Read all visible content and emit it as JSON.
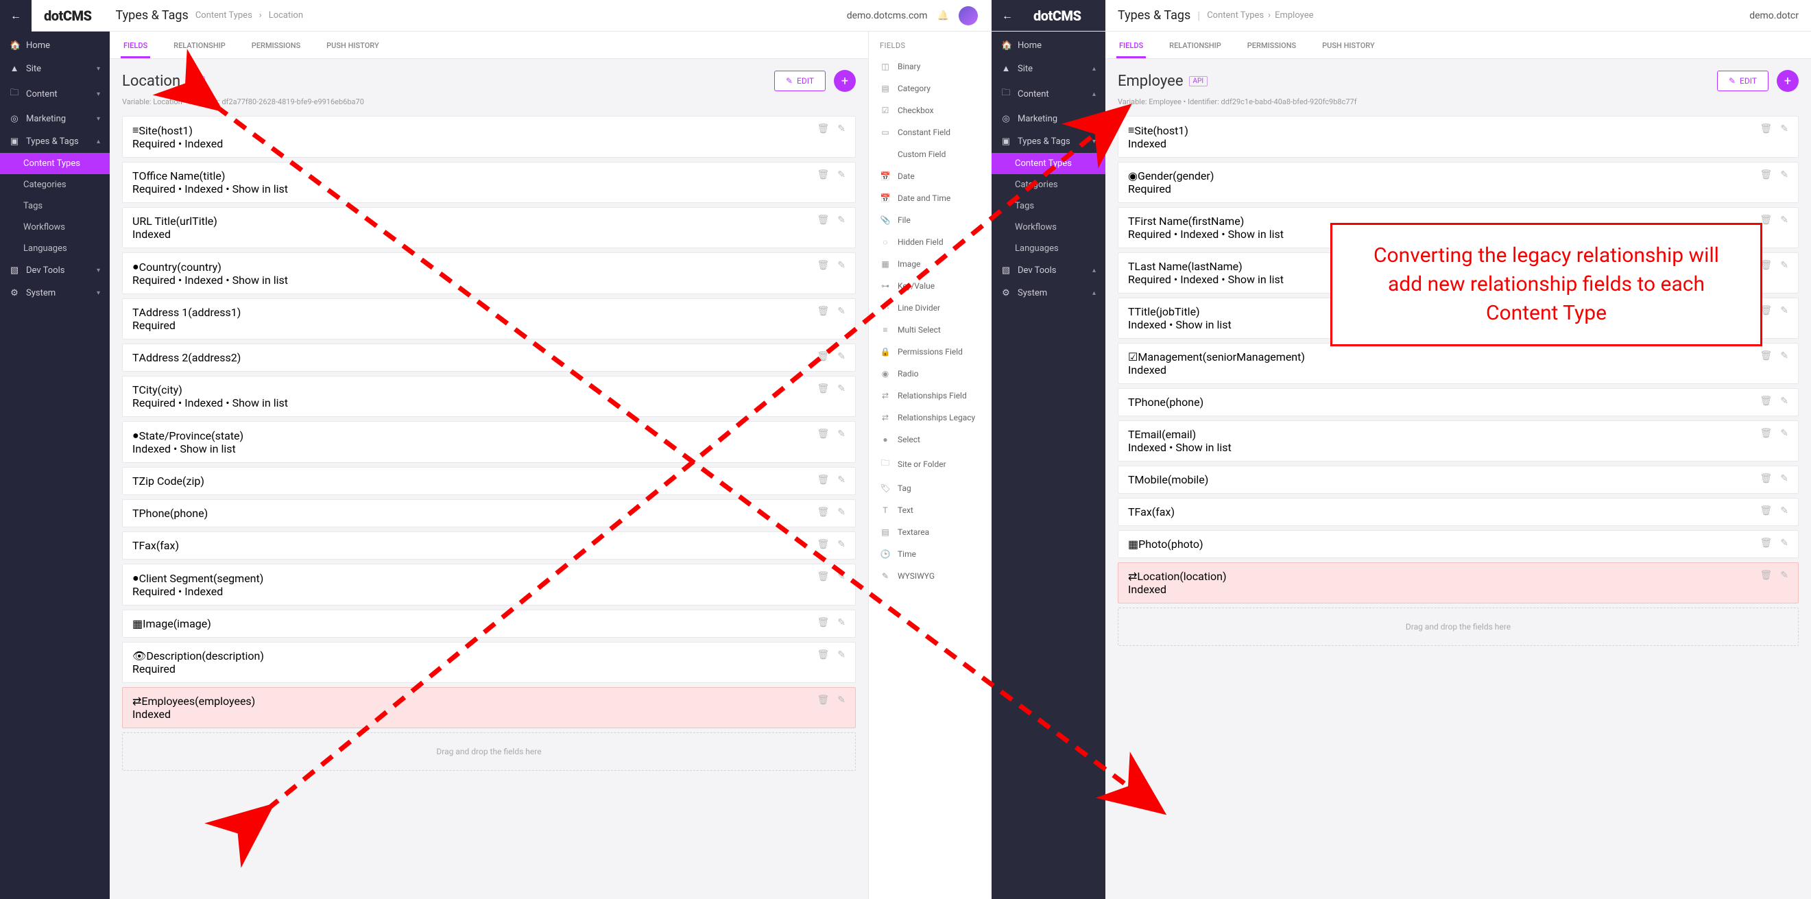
{
  "left": {
    "header": {
      "section": "Types & Tags",
      "crumb1": "Content Types",
      "crumb2": "Location",
      "domain": "demo.dotcms.com"
    },
    "nav": {
      "home": "Home",
      "site": "Site",
      "content": "Content",
      "marketing": "Marketing",
      "types": "Types & Tags",
      "contentTypes": "Content Types",
      "categories": "Categories",
      "tags": "Tags",
      "workflows": "Workflows",
      "languages": "Languages",
      "devtools": "Dev Tools",
      "system": "System"
    },
    "tabs": {
      "fields": "FIELDS",
      "relationship": "RELATIONSHIP",
      "permissions": "PERMISSIONS",
      "push": "PUSH HISTORY"
    },
    "title": "Location",
    "api": "API",
    "edit": "EDIT",
    "ident": "Variable: Location  •  Identifier: df2a77f80-2628-4819-bfe9-e9916eb6ba70",
    "drop": "Drag and drop the fields here",
    "fields": [
      {
        "icon": "≡",
        "label": "Site",
        "var": "(host1)",
        "meta": "Required  •  Indexed"
      },
      {
        "icon": "T",
        "label": "Office Name",
        "var": "(title)",
        "meta": "Required  •  Indexed  •  Show in list"
      },
      {
        "icon": "</>",
        "label": "URL Title",
        "var": "(urlTitle)",
        "meta": "Indexed"
      },
      {
        "icon": "●",
        "label": "Country",
        "var": "(country)",
        "meta": "Required  •  Indexed  •  Show in list"
      },
      {
        "icon": "T",
        "label": "Address 1",
        "var": "(address1)",
        "meta": "Required"
      },
      {
        "icon": "T",
        "label": "Address 2",
        "var": "(address2)",
        "meta": ""
      },
      {
        "icon": "T",
        "label": "City",
        "var": "(city)",
        "meta": "Required  •  Indexed  •  Show in list"
      },
      {
        "icon": "●",
        "label": "State/Province",
        "var": "(state)",
        "meta": "Indexed  •  Show in list"
      },
      {
        "icon": "T",
        "label": "Zip Code",
        "var": "(zip)",
        "meta": ""
      },
      {
        "icon": "T",
        "label": "Phone",
        "var": "(phone)",
        "meta": ""
      },
      {
        "icon": "T",
        "label": "Fax",
        "var": "(fax)",
        "meta": ""
      },
      {
        "icon": "●",
        "label": "Client Segment",
        "var": "(segment)",
        "meta": "Required  •  Indexed"
      },
      {
        "icon": "▦",
        "label": "Image",
        "var": "(image)",
        "meta": ""
      },
      {
        "icon": "👁",
        "label": "Description",
        "var": "(description)",
        "meta": "Required"
      },
      {
        "icon": "⇄",
        "label": "Employees",
        "var": "(employees)",
        "meta": "Indexed",
        "rel": true
      }
    ],
    "palette": {
      "header": "FIELDS",
      "items": [
        {
          "icon": "◫",
          "label": "Binary"
        },
        {
          "icon": "▤",
          "label": "Category"
        },
        {
          "icon": "☑",
          "label": "Checkbox"
        },
        {
          "icon": "▭",
          "label": "Constant Field"
        },
        {
          "icon": "</>",
          "label": "Custom Field"
        },
        {
          "icon": "📅",
          "label": "Date"
        },
        {
          "icon": "📅",
          "label": "Date and Time"
        },
        {
          "icon": "📎",
          "label": "File"
        },
        {
          "icon": "◌",
          "label": "Hidden Field"
        },
        {
          "icon": "▦",
          "label": "Image"
        },
        {
          "icon": "⊶",
          "label": "Key/Value"
        },
        {
          "icon": "⋯",
          "label": "Line Divider"
        },
        {
          "icon": "≡",
          "label": "Multi Select"
        },
        {
          "icon": "🔒",
          "label": "Permissions Field"
        },
        {
          "icon": "◉",
          "label": "Radio"
        },
        {
          "icon": "⇄",
          "label": "Relationships Field"
        },
        {
          "icon": "⇄",
          "label": "Relationships Legacy"
        },
        {
          "icon": "●",
          "label": "Select"
        },
        {
          "icon": "🗀",
          "label": "Site or Folder"
        },
        {
          "icon": "🏷",
          "label": "Tag"
        },
        {
          "icon": "T",
          "label": "Text"
        },
        {
          "icon": "▤",
          "label": "Textarea"
        },
        {
          "icon": "🕒",
          "label": "Time"
        },
        {
          "icon": "✎",
          "label": "WYSIWYG"
        }
      ]
    }
  },
  "right": {
    "header": {
      "section": "Types & Tags",
      "crumb1": "Content Types",
      "crumb2": "Employee",
      "domain": "demo.dotcr"
    },
    "title": "Employee",
    "api": "API",
    "edit": "EDIT",
    "ident": "Variable: Employee  •  Identifier: ddf29c1e-babd-40a8-bfed-920fc9b8c77f",
    "drop": "Drag and drop the fields here",
    "fields": [
      {
        "icon": "≡",
        "label": "Site",
        "var": "(host1)",
        "meta": "Indexed"
      },
      {
        "icon": "◉",
        "label": "Gender",
        "var": "(gender)",
        "meta": "Required"
      },
      {
        "icon": "T",
        "label": "First Name",
        "var": "(firstName)",
        "meta": "Required  •  Indexed  •  Show in list"
      },
      {
        "icon": "T",
        "label": "Last Name",
        "var": "(lastName)",
        "meta": "Required  •  Indexed  •  Show in list"
      },
      {
        "icon": "T",
        "label": "Title",
        "var": "(jobTitle)",
        "meta": "Indexed  •  Show in list"
      },
      {
        "icon": "☑",
        "label": "Management",
        "var": "(seniorManagement)",
        "meta": "Indexed"
      },
      {
        "icon": "T",
        "label": "Phone",
        "var": "(phone)",
        "meta": ""
      },
      {
        "icon": "T",
        "label": "Email",
        "var": "(email)",
        "meta": "Indexed  •  Show in list"
      },
      {
        "icon": "T",
        "label": "Mobile",
        "var": "(mobile)",
        "meta": ""
      },
      {
        "icon": "T",
        "label": "Fax",
        "var": "(fax)",
        "meta": ""
      },
      {
        "icon": "▦",
        "label": "Photo",
        "var": "(photo)",
        "meta": ""
      },
      {
        "icon": "⇄",
        "label": "Location",
        "var": "(location)",
        "meta": "Indexed",
        "rel": true
      }
    ]
  },
  "annotation": "Converting the legacy relationship will add new relationship fields to each Content Type"
}
